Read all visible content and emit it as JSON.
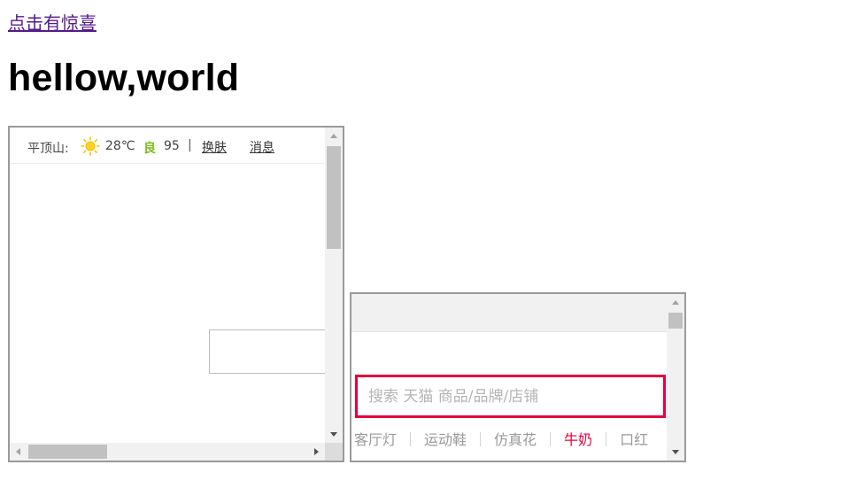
{
  "page": {
    "link_text": "点击有惊喜",
    "heading": "hellow,world"
  },
  "frame1": {
    "weather": {
      "city": "平顶山:",
      "icon": "sun-icon",
      "temperature": "28℃",
      "air_quality_label": "良",
      "air_quality_value": "95",
      "separator": "|",
      "skin_link": "换肤",
      "message_link": "消息"
    },
    "colors": {
      "air_quality": "#7cbb1b"
    }
  },
  "frame2": {
    "search": {
      "placeholder": "搜索 天猫 商品/品牌/店铺",
      "value": ""
    },
    "hotwords": [
      "客厅灯",
      "运动鞋",
      "仿真花",
      "牛奶",
      "口红"
    ],
    "highlighted_hotword": "牛奶",
    "colors": {
      "accent": "#e5003d"
    }
  }
}
